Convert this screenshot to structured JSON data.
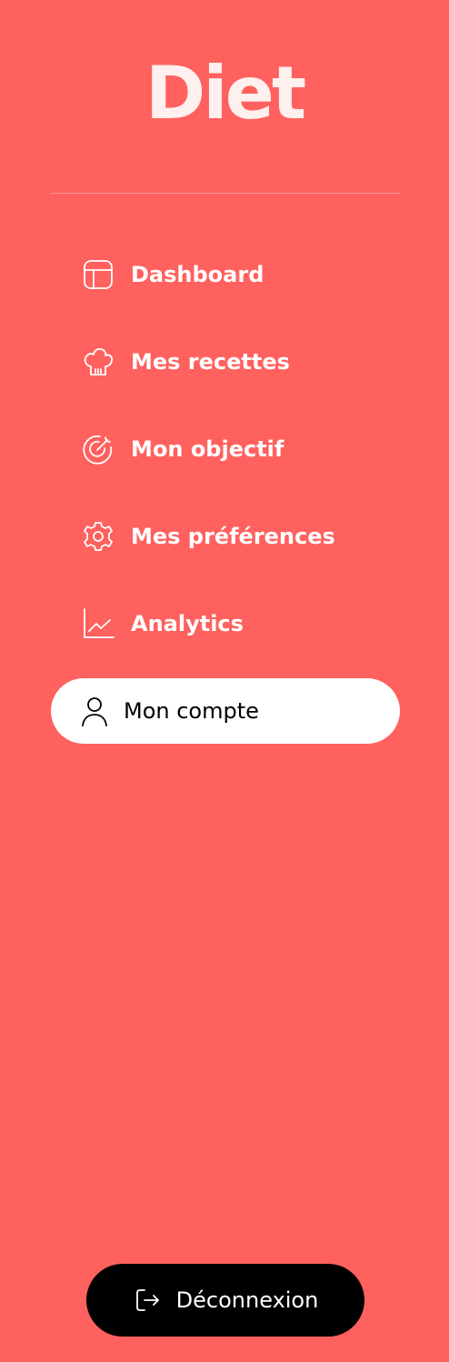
{
  "brand": {
    "logo_text": "Diet",
    "background_color": "#ff615e",
    "logo_color": "#fdf0ef"
  },
  "nav": {
    "items": [
      {
        "label": "Dashboard",
        "icon": "layout-icon",
        "active": false
      },
      {
        "label": "Mes recettes",
        "icon": "chef-hat-icon",
        "active": false
      },
      {
        "label": "Mon objectif",
        "icon": "target-icon",
        "active": false
      },
      {
        "label": "Mes préférences",
        "icon": "gear-icon",
        "active": false
      },
      {
        "label": "Analytics",
        "icon": "chart-line-icon",
        "active": false
      },
      {
        "label": "Mon compte",
        "icon": "user-icon",
        "active": true
      }
    ]
  },
  "logout": {
    "label": "Déconnexion",
    "icon": "logout-icon",
    "background_color": "#000000"
  }
}
